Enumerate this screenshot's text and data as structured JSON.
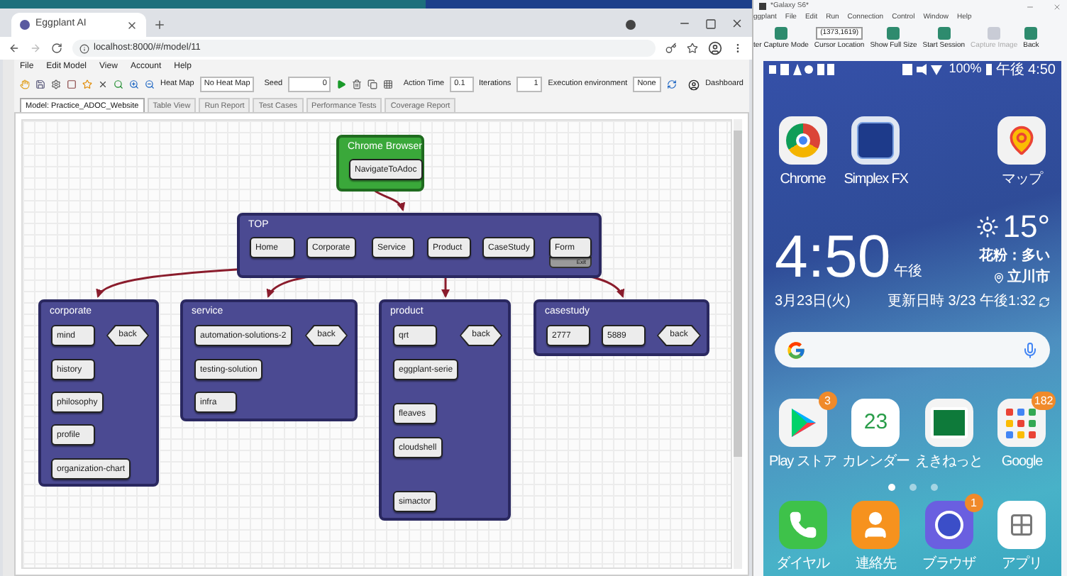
{
  "browser": {
    "tab_title": "Eggplant AI",
    "url": "localhost:8000/#/model/11"
  },
  "menu": [
    "File",
    "Edit Model",
    "View",
    "Account",
    "Help"
  ],
  "toolbar": {
    "heat_map_label": "Heat Map",
    "heat_map_value": "No Heat Map",
    "seed_label": "Seed",
    "seed_value": "0",
    "action_time_label": "Action Time",
    "action_time_value": "0.1",
    "iterations_label": "Iterations",
    "iterations_value": "1",
    "environment_label": "Execution environment",
    "environment_value": "None",
    "dashboard": "Dashboard"
  },
  "tabs": [
    {
      "label": "Model: Practice_ADOC_Website",
      "selected": true
    },
    {
      "label": "Table View",
      "selected": false
    },
    {
      "label": "Run Report",
      "selected": false
    },
    {
      "label": "Test Cases",
      "selected": false
    },
    {
      "label": "Performance Tests",
      "selected": false
    },
    {
      "label": "Coverage Report",
      "selected": false
    }
  ],
  "model": {
    "states": [
      {
        "title": "Chrome Browser",
        "kind": "start",
        "actions": [
          {
            "label": "NavigateToAdoc",
            "kind": "action"
          }
        ]
      },
      {
        "title": "TOP",
        "kind": "state",
        "actions": [
          {
            "label": "Home",
            "kind": "action"
          },
          {
            "label": "Corporate",
            "kind": "action"
          },
          {
            "label": "Service",
            "kind": "action"
          },
          {
            "label": "Product",
            "kind": "action"
          },
          {
            "label": "CaseStudy",
            "kind": "action"
          },
          {
            "label": "Form",
            "kind": "action",
            "footer": "Exit"
          }
        ]
      },
      {
        "title": "corporate",
        "kind": "state",
        "actions": [
          {
            "label": "mind",
            "kind": "action"
          },
          {
            "label": "back",
            "kind": "return"
          },
          {
            "label": "history",
            "kind": "action"
          },
          {
            "label": "philosophy",
            "kind": "action"
          },
          {
            "label": "profile",
            "kind": "action"
          },
          {
            "label": "organization-chart",
            "kind": "action"
          }
        ]
      },
      {
        "title": "service",
        "kind": "state",
        "actions": [
          {
            "label": "automation-solutions-2",
            "kind": "action"
          },
          {
            "label": "back",
            "kind": "return"
          },
          {
            "label": "testing-solution",
            "kind": "action"
          },
          {
            "label": "infra",
            "kind": "action"
          }
        ]
      },
      {
        "title": "product",
        "kind": "state",
        "actions": [
          {
            "label": "qrt",
            "kind": "action"
          },
          {
            "label": "back",
            "kind": "return"
          },
          {
            "label": "eggplant-serie",
            "kind": "action"
          },
          {
            "label": "fleaves",
            "kind": "action"
          },
          {
            "label": "cloudshell",
            "kind": "action"
          },
          {
            "label": "simactor",
            "kind": "action"
          }
        ]
      },
      {
        "title": "casestudy",
        "kind": "state",
        "actions": [
          {
            "label": "2777",
            "kind": "action"
          },
          {
            "label": "5889",
            "kind": "action"
          },
          {
            "label": "back",
            "kind": "return"
          }
        ]
      }
    ]
  },
  "emulator": {
    "title": "*Galaxy S6*",
    "menu": [
      "ggplant",
      "File",
      "Edit",
      "Run",
      "Connection",
      "Control",
      "Window",
      "Help"
    ],
    "tools": [
      {
        "label": "ter Capture Mode",
        "kind": "button",
        "disabled": false
      },
      {
        "label": "Cursor Location",
        "kind": "field",
        "value": "(1373,1619)",
        "disabled": false
      },
      {
        "label": "Show Full Size",
        "kind": "button",
        "disabled": false
      },
      {
        "label": "Start Session",
        "kind": "button",
        "disabled": false
      },
      {
        "label": "Capture Image",
        "kind": "button",
        "disabled": true
      },
      {
        "label": "Back",
        "kind": "button",
        "disabled": false
      }
    ],
    "phone": {
      "status": {
        "battery": "100%",
        "time": "午後 4:50"
      },
      "top_apps": [
        {
          "label": "Chrome"
        },
        {
          "label": "Simplex FX"
        },
        {
          "label": "マップ"
        }
      ],
      "clock": {
        "time": "4:50",
        "ampm": "午後",
        "date": "3月23日(火)"
      },
      "weather": {
        "temp": "15°",
        "pollen": "花粉：多い",
        "city": "立川市",
        "updated": "更新日時 3/23 午後1:32"
      },
      "apps": [
        {
          "label": "Play ストア",
          "badge": "3"
        },
        {
          "label": "カレンダー",
          "icon_text": "23"
        },
        {
          "label": "えきねっと"
        },
        {
          "label": "Google",
          "badge": "182"
        }
      ],
      "page_dots": [
        {
          "selected": true
        },
        {
          "selected": false
        },
        {
          "selected": false
        }
      ],
      "dock": [
        {
          "label": "ダイヤル"
        },
        {
          "label": "連絡先"
        },
        {
          "label": "ブラウザ",
          "badge": "1"
        },
        {
          "label": "アプリ"
        }
      ]
    }
  }
}
